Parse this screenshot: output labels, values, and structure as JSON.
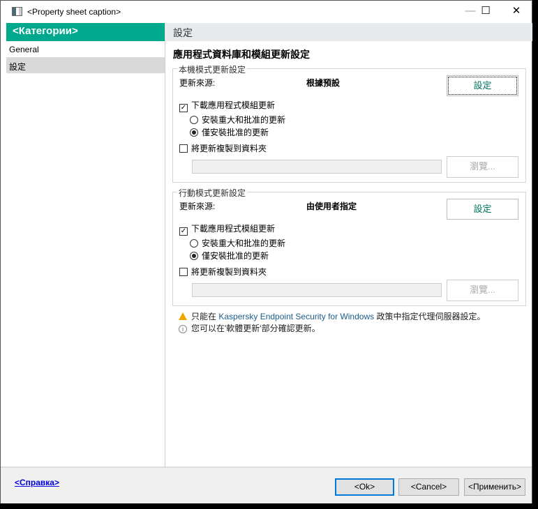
{
  "window": {
    "title": "<Property sheet caption>",
    "minimize": "—",
    "maximize": "☐",
    "close": "✕"
  },
  "sidebar": {
    "header": "<Категории>",
    "items": [
      {
        "label": "General"
      },
      {
        "label": "設定"
      }
    ]
  },
  "main": {
    "section_title": "設定",
    "heading": "應用程式資料庫和模組更新設定",
    "local": {
      "group_label": "本機模式更新設定",
      "source_label": "更新來源:",
      "source_value": "根據預設",
      "settings_button": "設定",
      "download_label": "下載應用程式模組更新",
      "download_checked": true,
      "radio1": "安裝重大和批准的更新",
      "radio2": "僅安裝批准的更新",
      "selected_radio": 2,
      "copy_label": "將更新複製到資料夾",
      "copy_checked": false,
      "folder_value": "",
      "browse_button": "瀏覽..."
    },
    "mobile": {
      "group_label": "行動模式更新設定",
      "source_label": "更新來源:",
      "source_value": "由使用者指定",
      "settings_button": "設定",
      "download_label": "下載應用程式模組更新",
      "download_checked": true,
      "radio1": "安裝重大和批准的更新",
      "radio2": "僅安裝批准的更新",
      "selected_radio": 2,
      "copy_label": "將更新複製到資料夾",
      "copy_checked": false,
      "folder_value": "",
      "browse_button": "瀏覽..."
    },
    "warning": {
      "prefix": "只能在 ",
      "product": "Kaspersky Endpoint Security for Windows",
      "suffix": " 政策中指定代理伺服器設定。"
    },
    "info": "您可以在'軟體更新'部分確認更新。"
  },
  "footer": {
    "help": "<Справка>",
    "ok": "<Ok>",
    "cancel": "<Cancel>",
    "apply": "<Применить>"
  },
  "colors": {
    "accent": "#00a88e",
    "link": "#0000e0",
    "focus": "#0078d7"
  }
}
